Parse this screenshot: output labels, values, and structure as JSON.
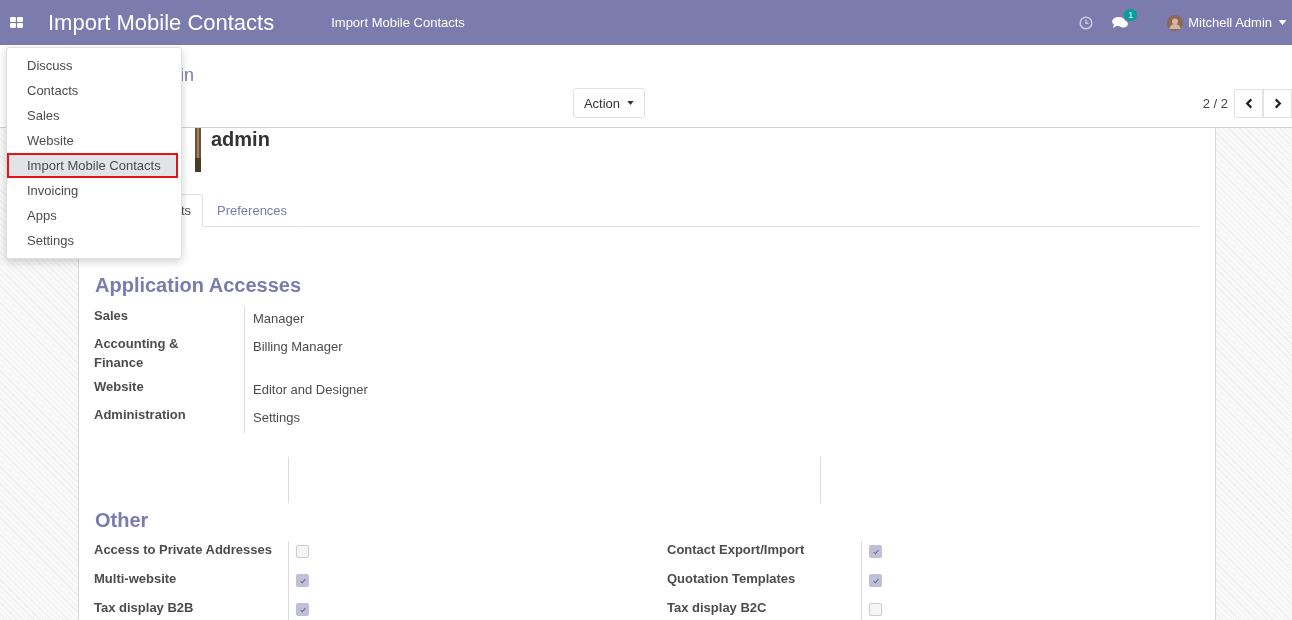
{
  "navbar": {
    "app_title": "Import Mobile Contacts",
    "menu_items": [
      "Import Mobile Contacts"
    ],
    "messages_badge": "1",
    "user": "Mitchell Admin"
  },
  "app_menu": {
    "items": [
      {
        "label": "Discuss",
        "selected": false
      },
      {
        "label": "Contacts",
        "selected": false
      },
      {
        "label": "Sales",
        "selected": false
      },
      {
        "label": "Website",
        "selected": false
      },
      {
        "label": "Import Mobile Contacts",
        "selected": true
      },
      {
        "label": "Invoicing",
        "selected": false
      },
      {
        "label": "Apps",
        "selected": false
      },
      {
        "label": "Settings",
        "selected": false
      }
    ]
  },
  "breadcrumb": "in",
  "action_button": "Action",
  "pager": "2 / 2",
  "record": {
    "name": "admin",
    "tabs": [
      {
        "label": "ts",
        "selected": true
      },
      {
        "label": "Preferences",
        "selected": false
      }
    ],
    "application_accesses": {
      "title": "Application Accesses",
      "rows": [
        {
          "label": "Sales",
          "value": "Manager"
        },
        {
          "label": "Accounting & Finance",
          "value": "Billing Manager"
        },
        {
          "label": "Website",
          "value": "Editor and Designer"
        },
        {
          "label": "Administration",
          "value": "Settings"
        }
      ]
    },
    "other": {
      "title": "Other",
      "left": [
        {
          "label": "Access to Private Addresses",
          "checked": false
        },
        {
          "label": "Multi-website",
          "checked": true
        },
        {
          "label": "Tax display B2B",
          "checked": true
        }
      ],
      "right": [
        {
          "label": "Contact Export/Import",
          "checked": true
        },
        {
          "label": "Quotation Templates",
          "checked": true
        },
        {
          "label": "Tax display B2C",
          "checked": false
        }
      ]
    }
  }
}
